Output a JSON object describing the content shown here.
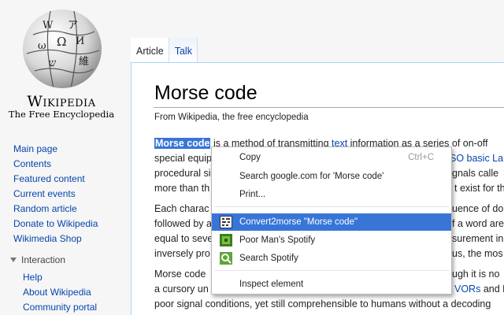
{
  "sidebar": {
    "wordmark": "Wikipedia",
    "tagline": "The Free Encyclopedia",
    "nav": [
      "Main page",
      "Contents",
      "Featured content",
      "Current events",
      "Random article",
      "Donate to Wikipedia",
      "Wikimedia Shop"
    ],
    "interaction_label": "Interaction",
    "interaction_items": [
      "Help",
      "About Wikipedia",
      "Community portal"
    ]
  },
  "tabs": {
    "article": "Article",
    "talk": "Talk"
  },
  "article": {
    "title": "Morse code",
    "from": "From Wikipedia, the free encyclopedia",
    "p1": [
      {
        "a": "Morse code",
        "b": " is a method of transmitting ",
        "c": "text",
        "d": " information as a series of on-off"
      },
      {
        "a": "special equip",
        "b": "",
        "c": "SO basic La",
        "d": ""
      },
      {
        "a": "procedural si",
        "b": "",
        "c": "",
        "d": "gnals calle"
      },
      {
        "a": "more than th",
        "b": "",
        "c": "",
        "d": "t exist for th"
      }
    ],
    "p2": [
      {
        "a": "Each charac",
        "b": "",
        "c": "",
        "d": "uence of do"
      },
      {
        "a": "followed by a",
        "b": "",
        "c": "",
        "d": "f a word are"
      },
      {
        "a": "equal to seve",
        "b": "",
        "c": "",
        "d": "surement in"
      },
      {
        "a": "inversely pro",
        "b": "",
        "c": "",
        "d": "us, the mos"
      }
    ],
    "p3": [
      {
        "a": "Morse code",
        "b": "",
        "c": "",
        "d": "ugh it is no"
      },
      {
        "a": "a cursory un",
        "b": "",
        "c": "VORs",
        "d": " and N"
      },
      {
        "a": "poor signal conditions, yet still comprehensible to humans without a decoding",
        "b": "",
        "c": "",
        "d": ""
      }
    ]
  },
  "context_menu": {
    "copy": "Copy",
    "copy_shortcut": "Ctrl+C",
    "search": "Search google.com for 'Morse code'",
    "print": "Print...",
    "convert": "Convert2morse \"Morse code\"",
    "pmspotify": "Poor Man's Spotify",
    "search_spotify": "Search Spotify",
    "inspect": "Inspect element"
  }
}
